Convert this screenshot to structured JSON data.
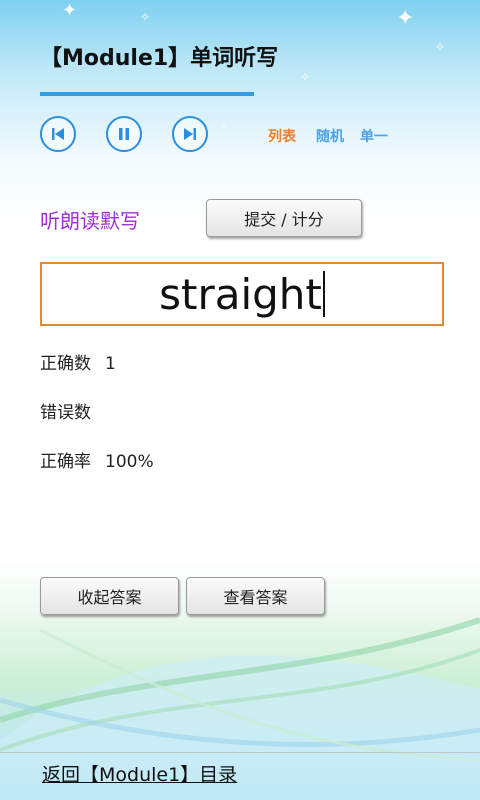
{
  "header": {
    "title": "【Module1】单词听写"
  },
  "controls": {
    "prev_icon": "skip-back-icon",
    "pause_icon": "pause-icon",
    "next_icon": "skip-forward-icon",
    "modes": [
      {
        "label": "列表",
        "color": "#f07c2a"
      },
      {
        "label": "随机",
        "color": "#4aa3e8"
      },
      {
        "label": "单一",
        "color": "#4aa3e8"
      }
    ]
  },
  "dictation": {
    "instruction": "听朗读默写",
    "submit_label": "提交 / 计分",
    "input_value": "straight"
  },
  "stats": {
    "correct_label": "正确数",
    "correct_value": "1",
    "wrong_label": "错误数",
    "wrong_value": "",
    "rate_label": "正确率",
    "rate_value": "100%"
  },
  "answers": {
    "collapse_label": "收起答案",
    "view_label": "查看答案"
  },
  "footer": {
    "back_label": "返回【Module1】目录"
  },
  "colors": {
    "accent_blue": "#2a8fe0",
    "instruction_purple": "#a02fd8",
    "input_border": "#e28a2e"
  }
}
